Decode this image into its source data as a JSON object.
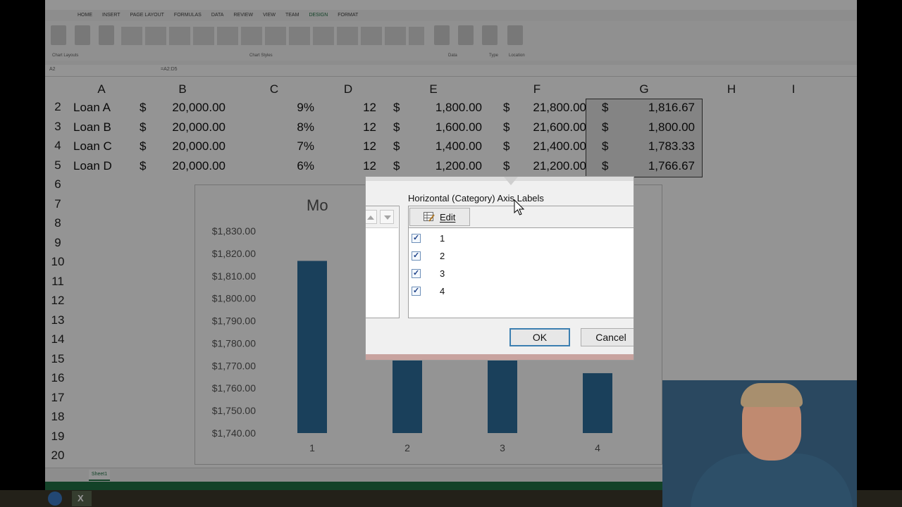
{
  "excel": {
    "tabs": [
      "HOME",
      "INSERT",
      "PAGE LAYOUT",
      "FORMULAS",
      "DATA",
      "REVIEW",
      "VIEW",
      "TEAM",
      "DESIGN",
      "FORMAT"
    ],
    "active_tab": "DESIGN",
    "ribbon_groups": [
      "Chart Layouts",
      "Chart Styles",
      "Data",
      "Type",
      "Location"
    ],
    "name_box": "A2",
    "formula": "=A2:D5",
    "columns": [
      "A",
      "B",
      "C",
      "D",
      "E",
      "F",
      "G",
      "H",
      "I"
    ],
    "rows": [
      "2",
      "3",
      "4",
      "5",
      "6",
      "7",
      "8",
      "9",
      "10",
      "11",
      "12",
      "13",
      "14",
      "15",
      "16",
      "17",
      "18",
      "19",
      "20"
    ],
    "data_rows": [
      {
        "a": "Loan A",
        "b": "20,000.00",
        "c": "9%",
        "d": "12",
        "e": "1,800.00",
        "f": "21,800.00",
        "g": "1,816.67"
      },
      {
        "a": "Loan B",
        "b": "20,000.00",
        "c": "8%",
        "d": "12",
        "e": "1,600.00",
        "f": "21,600.00",
        "g": "1,800.00"
      },
      {
        "a": "Loan C",
        "b": "20,000.00",
        "c": "7%",
        "d": "12",
        "e": "1,400.00",
        "f": "21,400.00",
        "g": "1,783.33"
      },
      {
        "a": "Loan D",
        "b": "20,000.00",
        "c": "6%",
        "d": "12",
        "e": "1,200.00",
        "f": "21,200.00",
        "g": "1,766.67"
      }
    ],
    "currency_symbol": "$",
    "sheet_tab": "Sheet1"
  },
  "chart_data": {
    "type": "bar",
    "title": "Mo",
    "categories": [
      "1",
      "2",
      "3",
      "4"
    ],
    "values": [
      1816.67,
      1800.0,
      1783.33,
      1766.67
    ],
    "ylim": [
      1740,
      1830
    ],
    "ytick_labels": [
      "$1,830.00",
      "$1,820.00",
      "$1,810.00",
      "$1,800.00",
      "$1,790.00",
      "$1,780.00",
      "$1,770.00",
      "$1,760.00",
      "$1,750.00",
      "$1,740.00"
    ],
    "bar_color": "#2e6e9e",
    "grid": false
  },
  "dialog": {
    "section_label": "Horizontal (Category) Axis Labels",
    "edit_label": "Edit",
    "items": [
      {
        "label": "1",
        "checked": true
      },
      {
        "label": "2",
        "checked": true
      },
      {
        "label": "3",
        "checked": true
      },
      {
        "label": "4",
        "checked": true
      }
    ],
    "ok_label": "OK",
    "cancel_label": "Cancel",
    "checkmark": "✓"
  },
  "colors": {
    "excel_green": "#217346",
    "ok_border": "#3c7fb1",
    "bar": "#2e6e9e"
  }
}
